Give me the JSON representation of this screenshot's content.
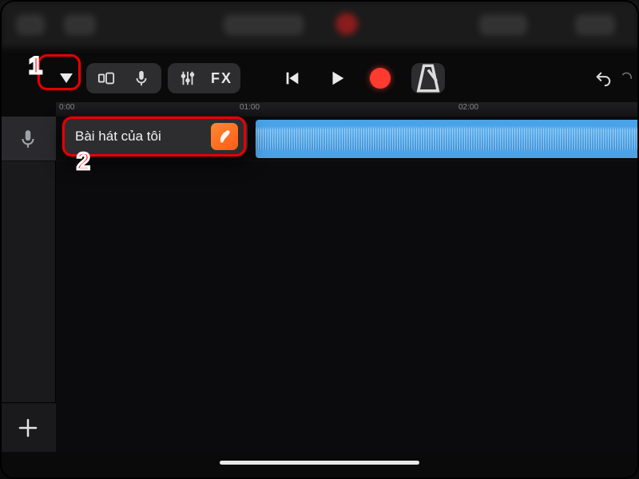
{
  "toolbar": {
    "fx_label": "FX"
  },
  "ruler": {
    "t0": "0:00",
    "t1": "01:00",
    "t2": "02:00"
  },
  "popover": {
    "title": "Bài hát của tôi"
  },
  "annotations": {
    "n1": "1",
    "n2": "2"
  },
  "icons": {
    "dropdown": "chevron-down-icon",
    "browser": "track-browser-icon",
    "mic": "microphone-icon",
    "mixer": "mixer-sliders-icon",
    "prev": "skip-back-icon",
    "play": "play-icon",
    "record": "record-icon",
    "metronome": "metronome-icon",
    "undo": "undo-icon",
    "mic_track": "microphone-icon",
    "add": "plus-icon",
    "garageband": "garageband-app-icon"
  }
}
